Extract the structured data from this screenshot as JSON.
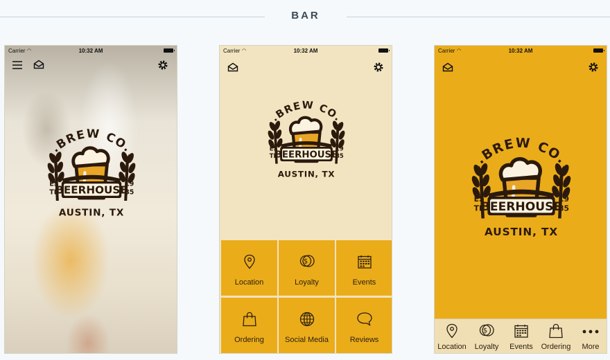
{
  "section_title": "BAR",
  "status": {
    "carrier": "Carrier",
    "time": "10:32 AM"
  },
  "logo": {
    "top": ".BREW CO.",
    "name": "BEERHOUSE",
    "est_left": "ES\nTB",
    "est_right": "19\n85",
    "city": "AUSTIN, TX"
  },
  "grid_tiles": [
    {
      "label": "Location",
      "icon": "location-pin-icon"
    },
    {
      "label": "Loyalty",
      "icon": "coin-icon"
    },
    {
      "label": "Events",
      "icon": "calendar-icon"
    },
    {
      "label": "Ordering",
      "icon": "shopping-bag-icon"
    },
    {
      "label": "Social Media",
      "icon": "globe-icon"
    },
    {
      "label": "Reviews",
      "icon": "chat-bubble-icon"
    }
  ],
  "tabbar": [
    {
      "label": "Location",
      "icon": "location-pin-icon"
    },
    {
      "label": "Loyalty",
      "icon": "coin-icon"
    },
    {
      "label": "Events",
      "icon": "calendar-icon"
    },
    {
      "label": "Ordering",
      "icon": "shopping-bag-icon"
    },
    {
      "label": "More",
      "icon": "more-dots-icon"
    }
  ],
  "colors": {
    "accent": "#ebac1a",
    "cream": "#f2e4c0",
    "dark": "#2a1f10"
  }
}
